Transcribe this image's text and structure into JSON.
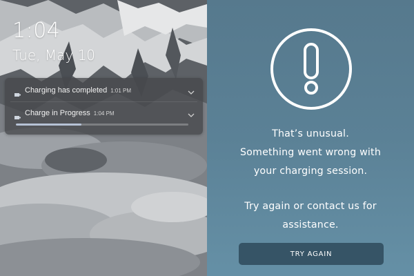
{
  "lock_screen": {
    "time": "1:04",
    "date": "Tue, May 10",
    "notifications": [
      {
        "title": "Charging has completed",
        "time": "1:01 PM",
        "icon": "charging-app-icon"
      },
      {
        "title": "Charge in Progress",
        "time": "1:04 PM",
        "icon": "charging-app-icon",
        "progress_percent": 38
      }
    ]
  },
  "error_panel": {
    "icon": "exclamation-circle-icon",
    "message_lines": [
      "That’s unusual.",
      "Something went wrong with",
      "your charging session."
    ],
    "help_lines": [
      "Try again or contact us for",
      "assistance."
    ],
    "button_label": "TRY AGAIN"
  },
  "colors": {
    "panel_accent": "#5b8196",
    "button_bg": "#365466",
    "progress_fill": "#b6c2d6"
  }
}
